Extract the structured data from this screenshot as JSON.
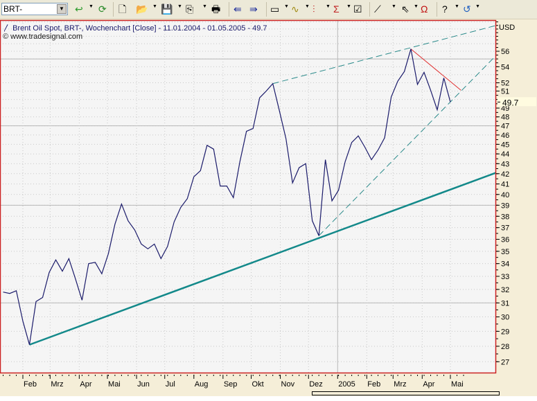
{
  "toolbar": {
    "symbol_value": "BRT-",
    "icons": [
      "refresh-icon",
      "update-icon",
      "new-document-icon",
      "open-folder-icon",
      "save-icon",
      "copy-icon",
      "print-icon",
      "chart-back-icon",
      "chart-forward-icon",
      "window-icon",
      "indicator-icon",
      "chart-type-icon",
      "sigma-icon",
      "properties-icon",
      "draw-line-icon",
      "cursor-icon",
      "magnet-icon",
      "help-icon",
      "undo-icon"
    ]
  },
  "header": {
    "title": "Brent Oil Spot, BRT-, Wochenchart [Close] - 11.01.2004 - 01.05.2005 - 49.7",
    "copyright": "www.tradesignal.com"
  },
  "colors": {
    "price_line": "#1a1a6a",
    "trendline": "#13898a",
    "dashed": "#2a8a8a",
    "resistance": "#e03030",
    "border": "#cc2222",
    "background": "#F5F5F5",
    "axis_bg": "#F5EED8"
  },
  "chart_data": {
    "type": "line",
    "title": "Brent Oil Spot, BRT-, Wochenchart [Close]",
    "ylabel": "USD",
    "yscale": "log",
    "ylim": [
      26.2,
      60
    ],
    "start_date": "2004-01-11",
    "interval_days": 7,
    "last_value_label": "49.7",
    "values": [
      31.8,
      31.7,
      31.9,
      29.7,
      28.1,
      31.1,
      31.4,
      33.3,
      34.3,
      33.4,
      34.4,
      32.8,
      31.2,
      34.0,
      34.1,
      33.2,
      34.8,
      37.3,
      39.1,
      37.6,
      36.8,
      35.6,
      35.2,
      35.6,
      34.4,
      35.4,
      37.5,
      38.8,
      39.6,
      41.7,
      42.3,
      44.9,
      44.5,
      40.8,
      40.8,
      39.7,
      43.2,
      46.4,
      46.7,
      50.2,
      51.0,
      51.9,
      48.7,
      45.6,
      41.1,
      42.6,
      43.0,
      37.6,
      36.3,
      43.4,
      39.4,
      40.4,
      43.2,
      45.2,
      45.9,
      44.7,
      43.4,
      44.4,
      45.7,
      50.3,
      52.2,
      53.4,
      56.3,
      51.8,
      53.3,
      51.1,
      48.8,
      52.6,
      49.7
    ],
    "y_ticks": [
      "56",
      "54",
      "52",
      "51",
      "49",
      "48",
      "47",
      "46",
      "45",
      "44",
      "43",
      "42",
      "41",
      "40",
      "39",
      "38",
      "37",
      "36",
      "35",
      "34",
      "33",
      "32",
      "31",
      "30",
      "29",
      "28",
      "27"
    ],
    "major_grid": [
      55,
      47,
      39,
      31
    ],
    "x_ticks": [
      {
        "label": "Feb",
        "date": "2004-02-01"
      },
      {
        "label": "Mrz",
        "date": "2004-03-01"
      },
      {
        "label": "Apr",
        "date": "2004-04-01"
      },
      {
        "label": "Mai",
        "date": "2004-05-01"
      },
      {
        "label": "Jun",
        "date": "2004-06-01"
      },
      {
        "label": "Jul",
        "date": "2004-07-01"
      },
      {
        "label": "Aug",
        "date": "2004-08-01"
      },
      {
        "label": "Sep",
        "date": "2004-09-01"
      },
      {
        "label": "Okt",
        "date": "2004-10-01"
      },
      {
        "label": "Nov",
        "date": "2004-11-01"
      },
      {
        "label": "Dez",
        "date": "2004-12-01"
      },
      {
        "label": "2005",
        "date": "2005-01-01"
      },
      {
        "label": "Feb",
        "date": "2005-02-01"
      },
      {
        "label": "Mrz",
        "date": "2005-03-01"
      },
      {
        "label": "Apr",
        "date": "2005-04-01"
      },
      {
        "label": "Mai",
        "date": "2005-05-01"
      }
    ],
    "trendlines": [
      {
        "name": "support-trendline",
        "style": "solid",
        "from": {
          "week": 4,
          "value": 28.1
        },
        "to": {
          "week": 75.8,
          "value": 42.3
        }
      },
      {
        "name": "upper-channel-line",
        "style": "dashed",
        "from": {
          "week": 41,
          "value": 51.9
        },
        "to": {
          "week": 75.8,
          "value": 59.7
        }
      },
      {
        "name": "lower-channel-line",
        "style": "dashed",
        "from": {
          "week": 48,
          "value": 36.3
        },
        "to": {
          "week": 75.8,
          "value": 56.2
        }
      },
      {
        "name": "resistance-line",
        "style": "solid-red",
        "from": {
          "week": 62,
          "value": 56.3
        },
        "to": {
          "week": 69.6,
          "value": 51.1
        }
      }
    ]
  }
}
